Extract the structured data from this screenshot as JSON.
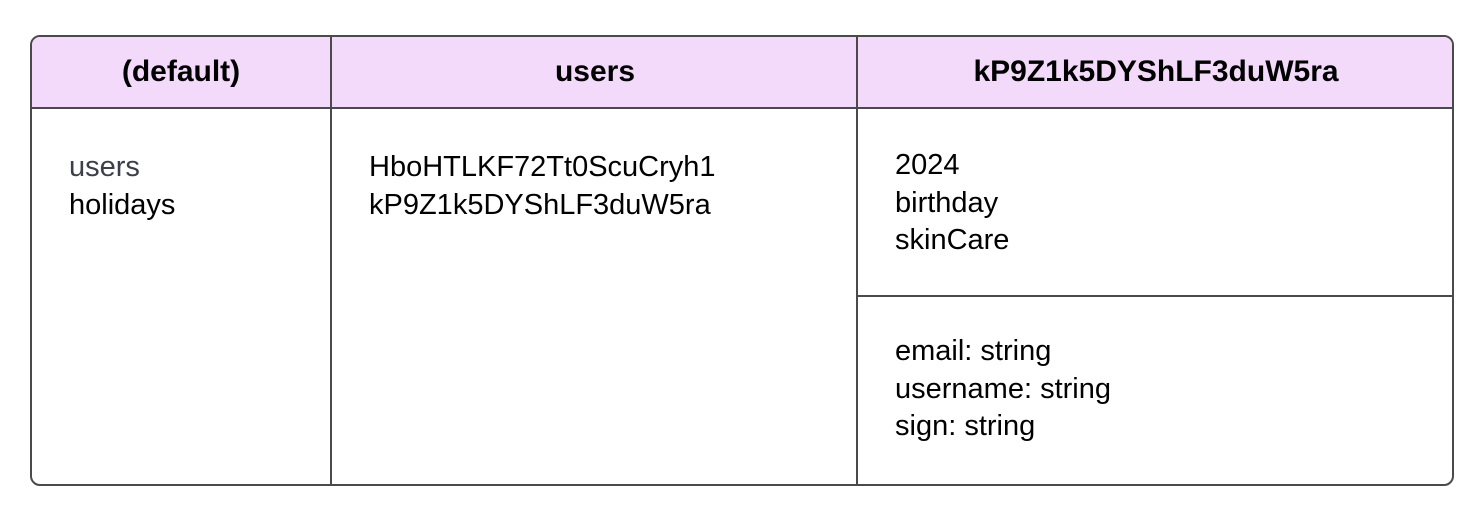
{
  "columns": [
    {
      "header": "(default)",
      "items": [
        "users",
        "holidays"
      ]
    },
    {
      "header": "users",
      "items": [
        "HboHTLKF72Tt0ScuCryh1",
        "kP9Z1k5DYShLF3duW5ra"
      ]
    },
    {
      "header": "kP9Z1k5DYShLF3duW5ra",
      "collections": [
        "2024",
        "birthday",
        "skinCare"
      ],
      "fields": [
        "email: string",
        "username: string",
        "sign: string"
      ]
    }
  ],
  "colors": {
    "header_bg": "#f3d9fa",
    "border": "#4a4a4a"
  }
}
